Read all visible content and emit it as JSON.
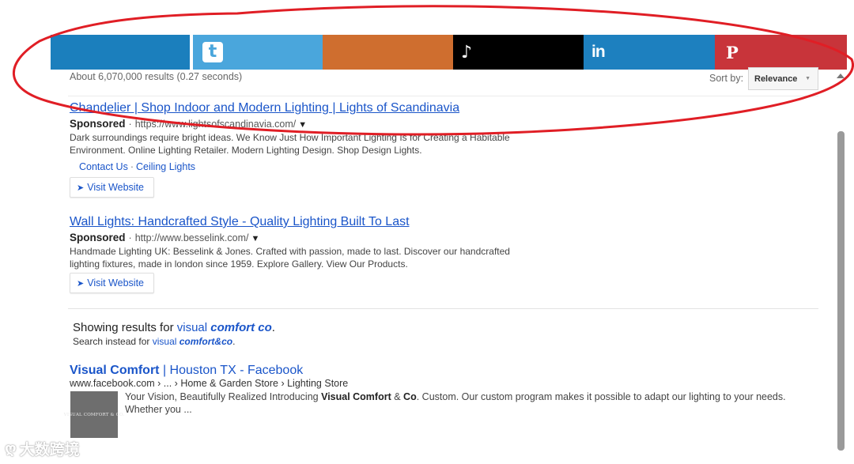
{
  "share_bar": {
    "twitter_glyph": "t",
    "tiktok_glyph": "♪",
    "linkedin_glyph": "in",
    "pinterest_glyph": "P",
    "colors": {
      "facebook": "#1b7fbd",
      "twitter": "#4aa6dc",
      "mix": "#cf6e2f",
      "tiktok": "#000000",
      "linkedin": "#1d80bf",
      "pinterest": "#c8343a"
    }
  },
  "results": {
    "count_text": "About 6,070,000 results (0.27 seconds)",
    "sort_label": "Sort by:",
    "sort_value": "Relevance",
    "sort_caret": "▼"
  },
  "ads": [
    {
      "title": "Chandelier | Shop Indoor and Modern Lighting | Lights of Scandinavia",
      "sponsored_label": "Sponsored",
      "separator": "·",
      "url": "https://www.lightsofscandinavia.com/",
      "arrow": "▼",
      "desc": "Dark surroundings require bright ideas. We Know Just How Important Lighting Is for Creating a Habitable Environment. Online Lighting Retailer. Modern Lighting Design. Shop Design Lights.",
      "sitelinks": [
        "Contact Us",
        "Ceiling Lights"
      ],
      "sitelink_sep": "·",
      "visit_glyph": "➤",
      "visit_label": "Visit Website"
    },
    {
      "title": "Wall Lights: Handcrafted Style - Quality Lighting Built To Last",
      "sponsored_label": "Sponsored",
      "separator": "·",
      "url": "http://www.besselink.com/",
      "arrow": "▼",
      "desc": "Handmade Lighting UK: Besselink & Jones. Crafted with passion, made to last. Discover our handcrafted lighting fixtures, made in london since 1959. Explore Gallery. View Our Products.",
      "visit_glyph": "➤",
      "visit_label": "Visit Website"
    }
  ],
  "correction": {
    "showing_prefix": "Showing results for ",
    "showing_plain": "visual ",
    "showing_bold": "comfort co",
    "showing_suffix": ".",
    "instead_prefix": "Search instead for ",
    "instead_plain": "visual ",
    "instead_bold": "comfort&co",
    "instead_suffix": "."
  },
  "organic": {
    "title_bold": "Visual Comfort",
    "title_rest": " | Houston TX - Facebook",
    "url": "www.facebook.com › ... › Home & Garden Store › Lighting Store",
    "thumb_text": "VISUAL COMFORT & CO.",
    "desc_1": "Your Vision, Beautifully Realized Introducing ",
    "desc_bold_1": "Visual Comfort",
    "desc_2": " & ",
    "desc_bold_2": "Co",
    "desc_3": ". Custom. Our custom program makes it possible to adapt our lighting to your needs. Whether you ..."
  },
  "watermark": {
    "icon": "ღ",
    "text": "大数跨境"
  },
  "annotation_color": "#e01e25"
}
